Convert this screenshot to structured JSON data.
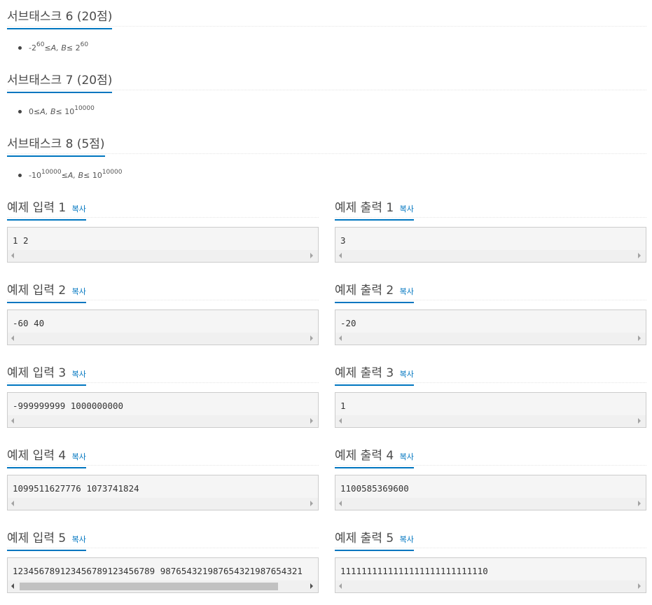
{
  "subtasks": [
    {
      "title": "서브태스크 6 (20점)",
      "constraint": {
        "a": "-2",
        "a_sup": "60",
        "mid": " ≤ ",
        "vars": "A, B",
        "mid2": " ≤ 2",
        "b_sup": "60"
      }
    },
    {
      "title": "서브태스크 7 (20점)",
      "constraint": {
        "a": "0",
        "a_sup": "",
        "mid": " ≤ ",
        "vars": "A, B",
        "mid2": " ≤ 10",
        "b_sup": "10000"
      }
    },
    {
      "title": "서브태스크 8 (5점)",
      "constraint": {
        "a": "-10",
        "a_sup": "10000",
        "mid": " ≤ ",
        "vars": "A, B",
        "mid2": " ≤ 10",
        "b_sup": "10000"
      }
    }
  ],
  "copy_label": "복사",
  "samples": [
    {
      "in_title": "예제 입력 1",
      "in": "1 2",
      "out_title": "예제 출력 1",
      "out": "3"
    },
    {
      "in_title": "예제 입력 2",
      "in": "-60 40",
      "out_title": "예제 출력 2",
      "out": "-20"
    },
    {
      "in_title": "예제 입력 3",
      "in": "-999999999 1000000000",
      "out_title": "예제 출력 3",
      "out": "1"
    },
    {
      "in_title": "예제 입력 4",
      "in": "1099511627776 1073741824",
      "out_title": "예제 출력 4",
      "out": "1100585369600"
    },
    {
      "in_title": "예제 입력 5",
      "in": "123456789123456789123456789 987654321987654321987654321",
      "out_title": "예제 출력 5",
      "out": "1111111111111111111111111110"
    }
  ]
}
